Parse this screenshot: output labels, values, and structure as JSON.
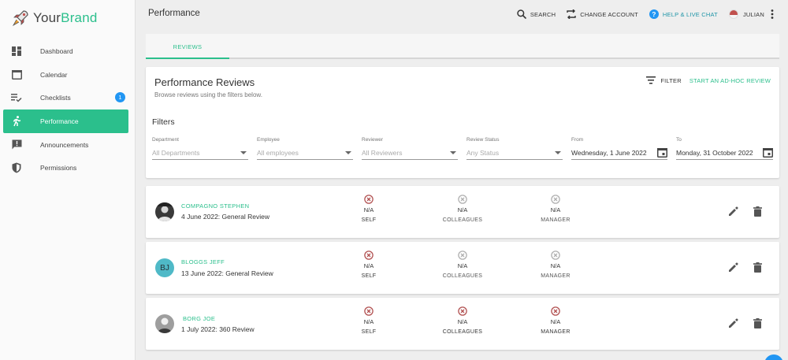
{
  "brand": {
    "part1": "Your",
    "part2": "Brand"
  },
  "sidebar": {
    "items": [
      {
        "label": "Dashboard",
        "icon": "dashboard-icon"
      },
      {
        "label": "Calendar",
        "icon": "calendar-icon"
      },
      {
        "label": "Checklists",
        "icon": "checklist-icon",
        "badge": "1"
      },
      {
        "label": "Performance",
        "icon": "running-icon",
        "active": true
      },
      {
        "label": "Announcements",
        "icon": "announcement-icon"
      },
      {
        "label": "Permissions",
        "icon": "shield-icon"
      }
    ]
  },
  "topbar": {
    "title": "Performance",
    "search": "SEARCH",
    "change_account": "CHANGE ACCOUNT",
    "help": "HELP & LIVE CHAT",
    "user": "JULIAN"
  },
  "tabs": [
    {
      "label": "REVIEWS",
      "active": true
    }
  ],
  "filters_card": {
    "title": "Performance Reviews",
    "subtitle": "Browse reviews using the filters below.",
    "filter_button": "FILTER",
    "adhoc_button": "START AN AD-HOC REVIEW",
    "filters_heading": "Filters",
    "fields": {
      "department": {
        "label": "Department",
        "placeholder": "All Departments"
      },
      "employee": {
        "label": "Employee",
        "placeholder": "All employees"
      },
      "reviewer": {
        "label": "Reviewer",
        "placeholder": "All Reviewers"
      },
      "status": {
        "label": "Review Status",
        "placeholder": "Any Status"
      },
      "from": {
        "label": "From",
        "value": "Wednesday, 1 June 2022"
      },
      "to": {
        "label": "To",
        "value": "Monday, 31 October 2022"
      }
    }
  },
  "reviews": [
    {
      "name": "COMPAGNO STEPHEN",
      "description": "4 June 2022: General Review",
      "avatar": "photo",
      "self": {
        "value": "N/A",
        "label": "SELF"
      },
      "colleagues": {
        "value": "N/A",
        "label": "COLLEAGUES"
      },
      "manager": {
        "value": "N/A",
        "label": "MANAGER"
      }
    },
    {
      "name": "BLOGGS JEFF",
      "description": "13 June 2022: General Review",
      "avatar_initials": "BJ",
      "self": {
        "value": "N/A",
        "label": "SELF"
      },
      "colleagues": {
        "value": "N/A",
        "label": "COLLEAGUES"
      },
      "manager": {
        "value": "N/A",
        "label": "MANAGER"
      }
    },
    {
      "name": "BORG JOE",
      "description": "1 July 2022: 360 Review",
      "avatar": "photo",
      "self": {
        "value": "N/A",
        "label": "SELF"
      },
      "colleagues": {
        "value": "N/A",
        "label": "COLLEAGUES"
      },
      "manager": {
        "value": "N/A",
        "label": "MANAGER"
      }
    }
  ],
  "colors": {
    "accent": "#2bbf8c",
    "badge": "#2196f3",
    "help": "#2196a8",
    "cancel_red": "#b25252",
    "cancel_grey": "#b0b0b0"
  }
}
